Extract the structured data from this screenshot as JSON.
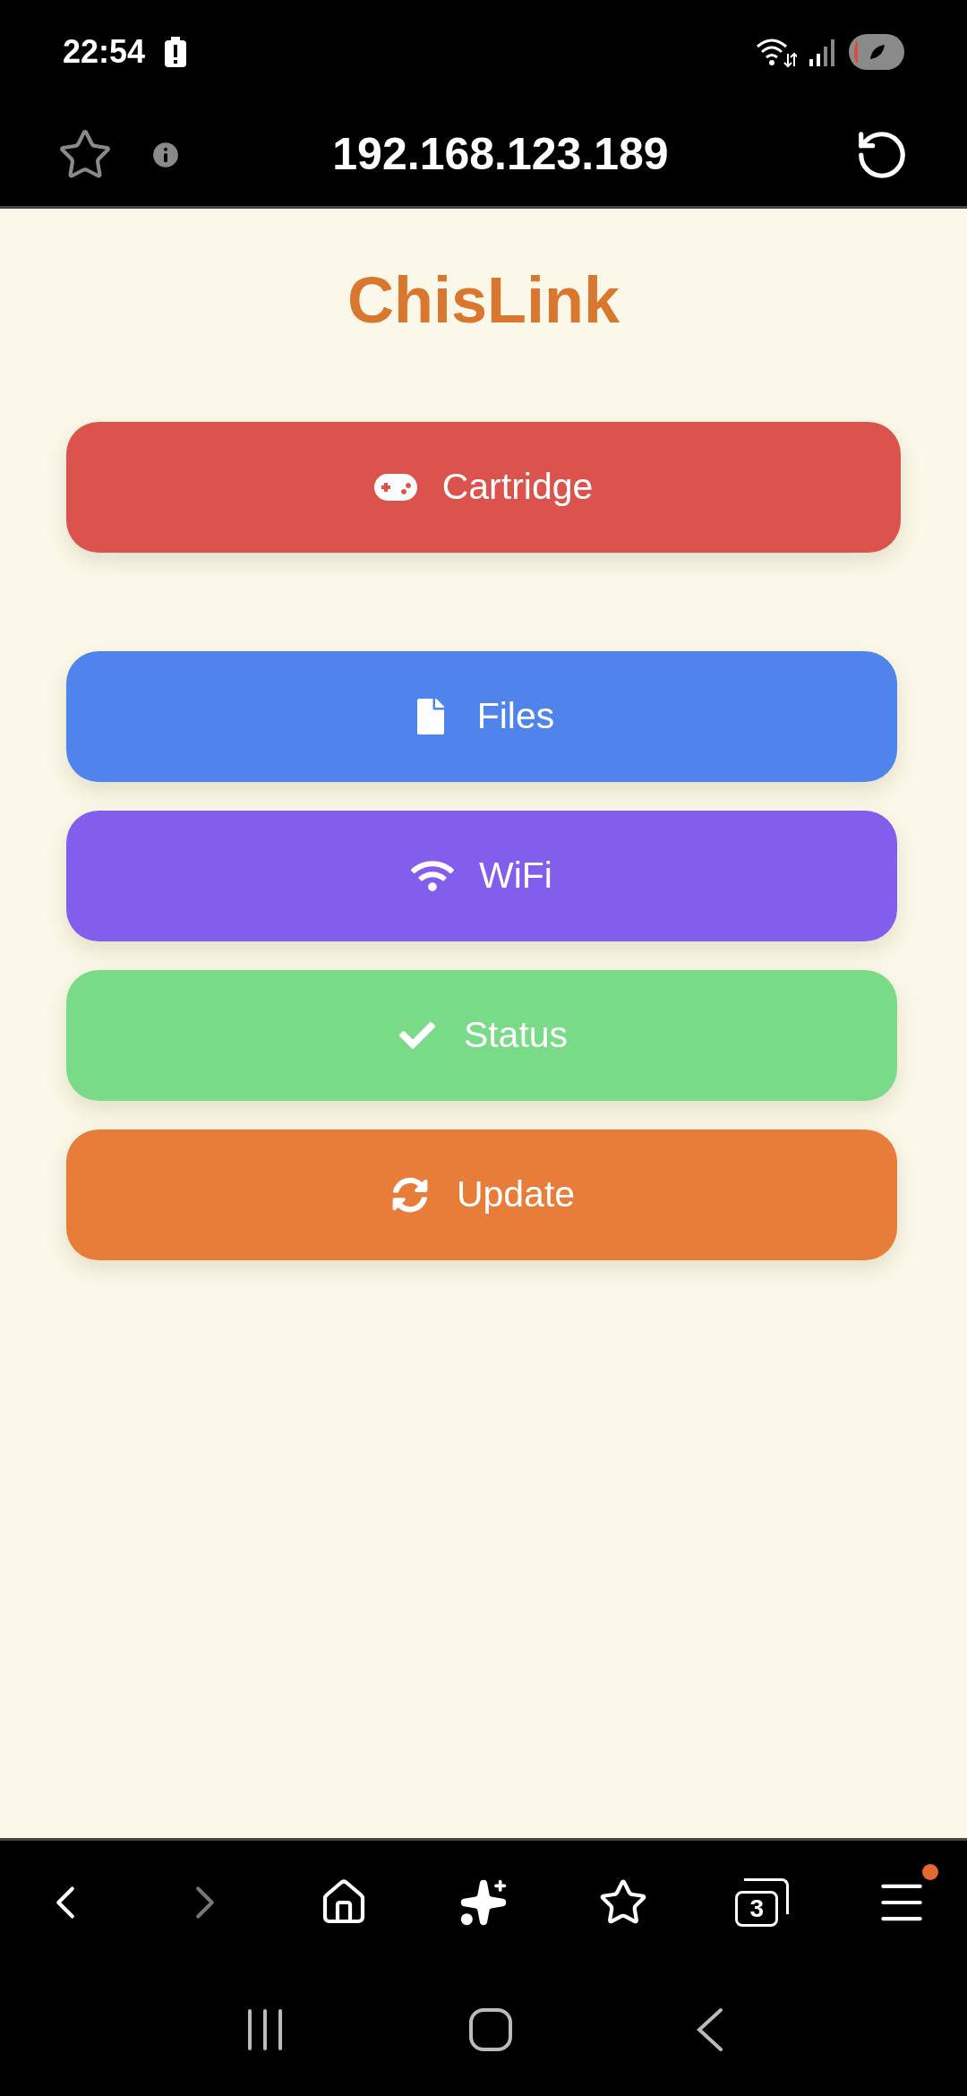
{
  "status_bar": {
    "time": "22:54"
  },
  "address_bar": {
    "url": "192.168.123.189"
  },
  "page": {
    "title": "ChisLink",
    "top_buttons": [
      {
        "label": "Cartridge",
        "kind": "gamepad",
        "color": "#dc534e"
      }
    ],
    "buttons": [
      {
        "label": "Files",
        "kind": "file",
        "color": "#4e84ec"
      },
      {
        "label": "WiFi",
        "kind": "wifi",
        "color": "#835dec"
      },
      {
        "label": "Status",
        "kind": "check",
        "color": "#79db88"
      },
      {
        "label": "Update",
        "kind": "sync",
        "color": "#e87c39"
      }
    ]
  },
  "browser_toolbar": {
    "items": [
      {
        "kind": "back",
        "disabled": false
      },
      {
        "kind": "forward",
        "disabled": true
      },
      {
        "kind": "home",
        "disabled": false
      },
      {
        "kind": "sparkle",
        "disabled": false
      },
      {
        "kind": "bookmarks",
        "disabled": false
      },
      {
        "kind": "tabs",
        "disabled": false,
        "count": "3"
      },
      {
        "kind": "menu",
        "disabled": false,
        "badge": true
      }
    ]
  }
}
